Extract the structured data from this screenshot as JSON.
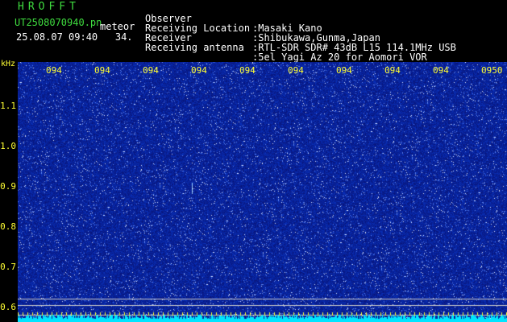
{
  "header": {
    "title": "HROFFT",
    "filename": "UT2508070940.pn",
    "filename_suffix": "meteor",
    "timestamp": "25.08.07 09:40",
    "timestamp_extra": "34.",
    "info": [
      {
        "label": "Observer",
        "value": ":Masaki Kano"
      },
      {
        "label": "Receiving Location",
        "value": ":Shibukawa,Gunma,Japan"
      },
      {
        "label": "Receiver",
        "value": ":RTL-SDR SDR# 43dB L15 114.1MHz USB"
      },
      {
        "label": "Receiving antenna",
        "value": ":5el Yagi Az 20 for Aomori VOR"
      }
    ]
  },
  "axis": {
    "unit": "kHz",
    "y_ticks": [
      "1.1",
      "1.0",
      "0.9",
      "0.8",
      "0.7",
      "0.6"
    ],
    "x_ticks": [
      "094",
      "094",
      "094",
      "094",
      "094",
      "094",
      "094",
      "094",
      "094",
      "0950"
    ]
  },
  "colors": {
    "background": "#000000",
    "waterfall": "#0a1a8c",
    "text_green": "#3fdc3f",
    "text_yellow": "#ffff33",
    "baseline": "#00e5ff"
  }
}
